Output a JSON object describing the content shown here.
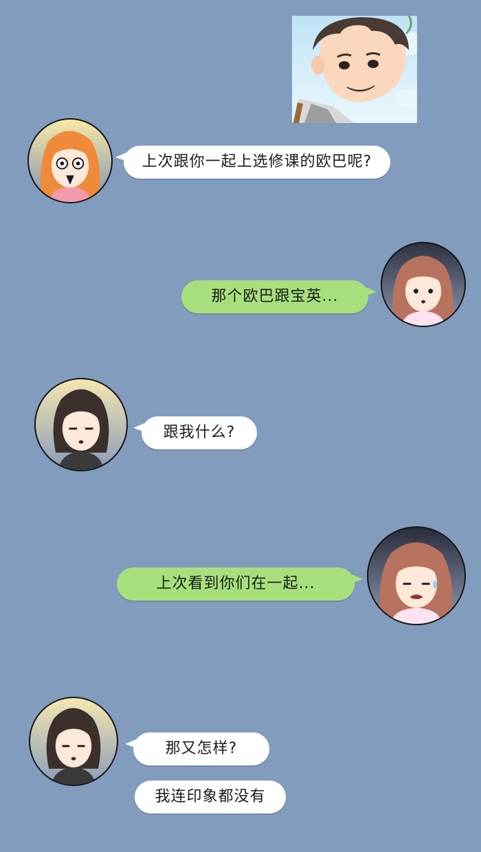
{
  "colors": {
    "background": "#829cbd",
    "incoming_bubble": "#ffffff",
    "outgoing_bubble": "#a6e07c"
  },
  "shared_photo": {
    "icon": "boy-photo"
  },
  "messages": [
    {
      "side": "left",
      "avatar": "girl-surprised-avatar",
      "text": "上次跟你一起上选修课的欧巴呢?"
    },
    {
      "side": "right",
      "avatar": "girl-worried-avatar",
      "text": "那个欧巴跟宝英..."
    },
    {
      "side": "left",
      "avatar": "girl-bob-avatar",
      "text": "跟我什么?"
    },
    {
      "side": "right",
      "avatar": "girl-sweating-avatar",
      "text": "上次看到你们在一起..."
    },
    {
      "side": "left",
      "avatar": "girl-bob-avatar",
      "text": "那又怎样?"
    },
    {
      "side": "left",
      "avatar": "",
      "text": "我连印象都没有"
    }
  ]
}
